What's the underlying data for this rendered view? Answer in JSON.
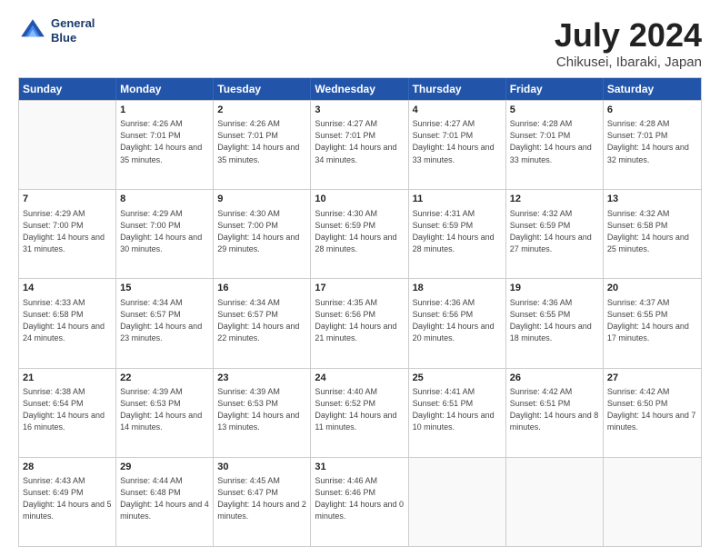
{
  "header": {
    "logo_line1": "General",
    "logo_line2": "Blue",
    "title": "July 2024",
    "subtitle": "Chikusei, Ibaraki, Japan"
  },
  "days": [
    "Sunday",
    "Monday",
    "Tuesday",
    "Wednesday",
    "Thursday",
    "Friday",
    "Saturday"
  ],
  "rows": [
    [
      {
        "day": "",
        "sunrise": "",
        "sunset": "",
        "daylight": ""
      },
      {
        "day": "1",
        "sunrise": "Sunrise: 4:26 AM",
        "sunset": "Sunset: 7:01 PM",
        "daylight": "Daylight: 14 hours and 35 minutes."
      },
      {
        "day": "2",
        "sunrise": "Sunrise: 4:26 AM",
        "sunset": "Sunset: 7:01 PM",
        "daylight": "Daylight: 14 hours and 35 minutes."
      },
      {
        "day": "3",
        "sunrise": "Sunrise: 4:27 AM",
        "sunset": "Sunset: 7:01 PM",
        "daylight": "Daylight: 14 hours and 34 minutes."
      },
      {
        "day": "4",
        "sunrise": "Sunrise: 4:27 AM",
        "sunset": "Sunset: 7:01 PM",
        "daylight": "Daylight: 14 hours and 33 minutes."
      },
      {
        "day": "5",
        "sunrise": "Sunrise: 4:28 AM",
        "sunset": "Sunset: 7:01 PM",
        "daylight": "Daylight: 14 hours and 33 minutes."
      },
      {
        "day": "6",
        "sunrise": "Sunrise: 4:28 AM",
        "sunset": "Sunset: 7:01 PM",
        "daylight": "Daylight: 14 hours and 32 minutes."
      }
    ],
    [
      {
        "day": "7",
        "sunrise": "Sunrise: 4:29 AM",
        "sunset": "Sunset: 7:00 PM",
        "daylight": "Daylight: 14 hours and 31 minutes."
      },
      {
        "day": "8",
        "sunrise": "Sunrise: 4:29 AM",
        "sunset": "Sunset: 7:00 PM",
        "daylight": "Daylight: 14 hours and 30 minutes."
      },
      {
        "day": "9",
        "sunrise": "Sunrise: 4:30 AM",
        "sunset": "Sunset: 7:00 PM",
        "daylight": "Daylight: 14 hours and 29 minutes."
      },
      {
        "day": "10",
        "sunrise": "Sunrise: 4:30 AM",
        "sunset": "Sunset: 6:59 PM",
        "daylight": "Daylight: 14 hours and 28 minutes."
      },
      {
        "day": "11",
        "sunrise": "Sunrise: 4:31 AM",
        "sunset": "Sunset: 6:59 PM",
        "daylight": "Daylight: 14 hours and 28 minutes."
      },
      {
        "day": "12",
        "sunrise": "Sunrise: 4:32 AM",
        "sunset": "Sunset: 6:59 PM",
        "daylight": "Daylight: 14 hours and 27 minutes."
      },
      {
        "day": "13",
        "sunrise": "Sunrise: 4:32 AM",
        "sunset": "Sunset: 6:58 PM",
        "daylight": "Daylight: 14 hours and 25 minutes."
      }
    ],
    [
      {
        "day": "14",
        "sunrise": "Sunrise: 4:33 AM",
        "sunset": "Sunset: 6:58 PM",
        "daylight": "Daylight: 14 hours and 24 minutes."
      },
      {
        "day": "15",
        "sunrise": "Sunrise: 4:34 AM",
        "sunset": "Sunset: 6:57 PM",
        "daylight": "Daylight: 14 hours and 23 minutes."
      },
      {
        "day": "16",
        "sunrise": "Sunrise: 4:34 AM",
        "sunset": "Sunset: 6:57 PM",
        "daylight": "Daylight: 14 hours and 22 minutes."
      },
      {
        "day": "17",
        "sunrise": "Sunrise: 4:35 AM",
        "sunset": "Sunset: 6:56 PM",
        "daylight": "Daylight: 14 hours and 21 minutes."
      },
      {
        "day": "18",
        "sunrise": "Sunrise: 4:36 AM",
        "sunset": "Sunset: 6:56 PM",
        "daylight": "Daylight: 14 hours and 20 minutes."
      },
      {
        "day": "19",
        "sunrise": "Sunrise: 4:36 AM",
        "sunset": "Sunset: 6:55 PM",
        "daylight": "Daylight: 14 hours and 18 minutes."
      },
      {
        "day": "20",
        "sunrise": "Sunrise: 4:37 AM",
        "sunset": "Sunset: 6:55 PM",
        "daylight": "Daylight: 14 hours and 17 minutes."
      }
    ],
    [
      {
        "day": "21",
        "sunrise": "Sunrise: 4:38 AM",
        "sunset": "Sunset: 6:54 PM",
        "daylight": "Daylight: 14 hours and 16 minutes."
      },
      {
        "day": "22",
        "sunrise": "Sunrise: 4:39 AM",
        "sunset": "Sunset: 6:53 PM",
        "daylight": "Daylight: 14 hours and 14 minutes."
      },
      {
        "day": "23",
        "sunrise": "Sunrise: 4:39 AM",
        "sunset": "Sunset: 6:53 PM",
        "daylight": "Daylight: 14 hours and 13 minutes."
      },
      {
        "day": "24",
        "sunrise": "Sunrise: 4:40 AM",
        "sunset": "Sunset: 6:52 PM",
        "daylight": "Daylight: 14 hours and 11 minutes."
      },
      {
        "day": "25",
        "sunrise": "Sunrise: 4:41 AM",
        "sunset": "Sunset: 6:51 PM",
        "daylight": "Daylight: 14 hours and 10 minutes."
      },
      {
        "day": "26",
        "sunrise": "Sunrise: 4:42 AM",
        "sunset": "Sunset: 6:51 PM",
        "daylight": "Daylight: 14 hours and 8 minutes."
      },
      {
        "day": "27",
        "sunrise": "Sunrise: 4:42 AM",
        "sunset": "Sunset: 6:50 PM",
        "daylight": "Daylight: 14 hours and 7 minutes."
      }
    ],
    [
      {
        "day": "28",
        "sunrise": "Sunrise: 4:43 AM",
        "sunset": "Sunset: 6:49 PM",
        "daylight": "Daylight: 14 hours and 5 minutes."
      },
      {
        "day": "29",
        "sunrise": "Sunrise: 4:44 AM",
        "sunset": "Sunset: 6:48 PM",
        "daylight": "Daylight: 14 hours and 4 minutes."
      },
      {
        "day": "30",
        "sunrise": "Sunrise: 4:45 AM",
        "sunset": "Sunset: 6:47 PM",
        "daylight": "Daylight: 14 hours and 2 minutes."
      },
      {
        "day": "31",
        "sunrise": "Sunrise: 4:46 AM",
        "sunset": "Sunset: 6:46 PM",
        "daylight": "Daylight: 14 hours and 0 minutes."
      },
      {
        "day": "",
        "sunrise": "",
        "sunset": "",
        "daylight": ""
      },
      {
        "day": "",
        "sunrise": "",
        "sunset": "",
        "daylight": ""
      },
      {
        "day": "",
        "sunrise": "",
        "sunset": "",
        "daylight": ""
      }
    ]
  ]
}
